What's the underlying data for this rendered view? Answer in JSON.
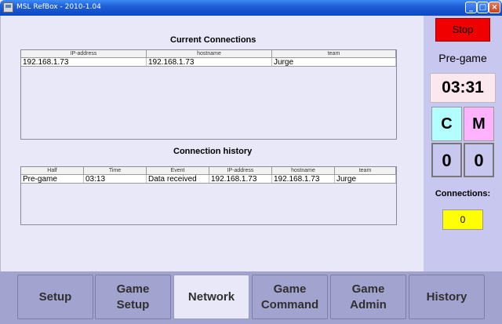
{
  "window": {
    "title": "MSL RefBox  -  2010-1.04"
  },
  "current_connections": {
    "title": "Current Connections",
    "columns": [
      "IP-address",
      "hostname",
      "team"
    ],
    "rows": [
      [
        "192.168.1.73",
        "192.168.1.73",
        "Jurge"
      ]
    ]
  },
  "connection_history": {
    "title": "Connection history",
    "columns": [
      "Half",
      "Time",
      "Event",
      "IP-address",
      "hostname",
      "team"
    ],
    "rows": [
      [
        "Pre-game",
        "03:13",
        "Data received",
        "192.168.1.73",
        "192.168.1.73",
        "Jurge"
      ]
    ]
  },
  "right_panel": {
    "stop_label": "Stop",
    "stop_color": "#f00000",
    "phase": "Pre-game",
    "timer": "03:31",
    "team_c": {
      "label": "C",
      "color": "#b3ffff",
      "score": "0"
    },
    "team_m": {
      "label": "M",
      "color": "#ffb3ff",
      "score": "0"
    },
    "connections_label": "Connections:",
    "connections_count": "0",
    "connections_color": "#ffff00"
  },
  "nav": {
    "tabs": [
      {
        "label": "Setup",
        "active": false
      },
      {
        "label": "Game\nSetup",
        "active": false
      },
      {
        "label": "Network",
        "active": true
      },
      {
        "label": "Game\nCommand",
        "active": false
      },
      {
        "label": "Game\nAdmin",
        "active": false
      },
      {
        "label": "History",
        "active": false
      }
    ]
  }
}
